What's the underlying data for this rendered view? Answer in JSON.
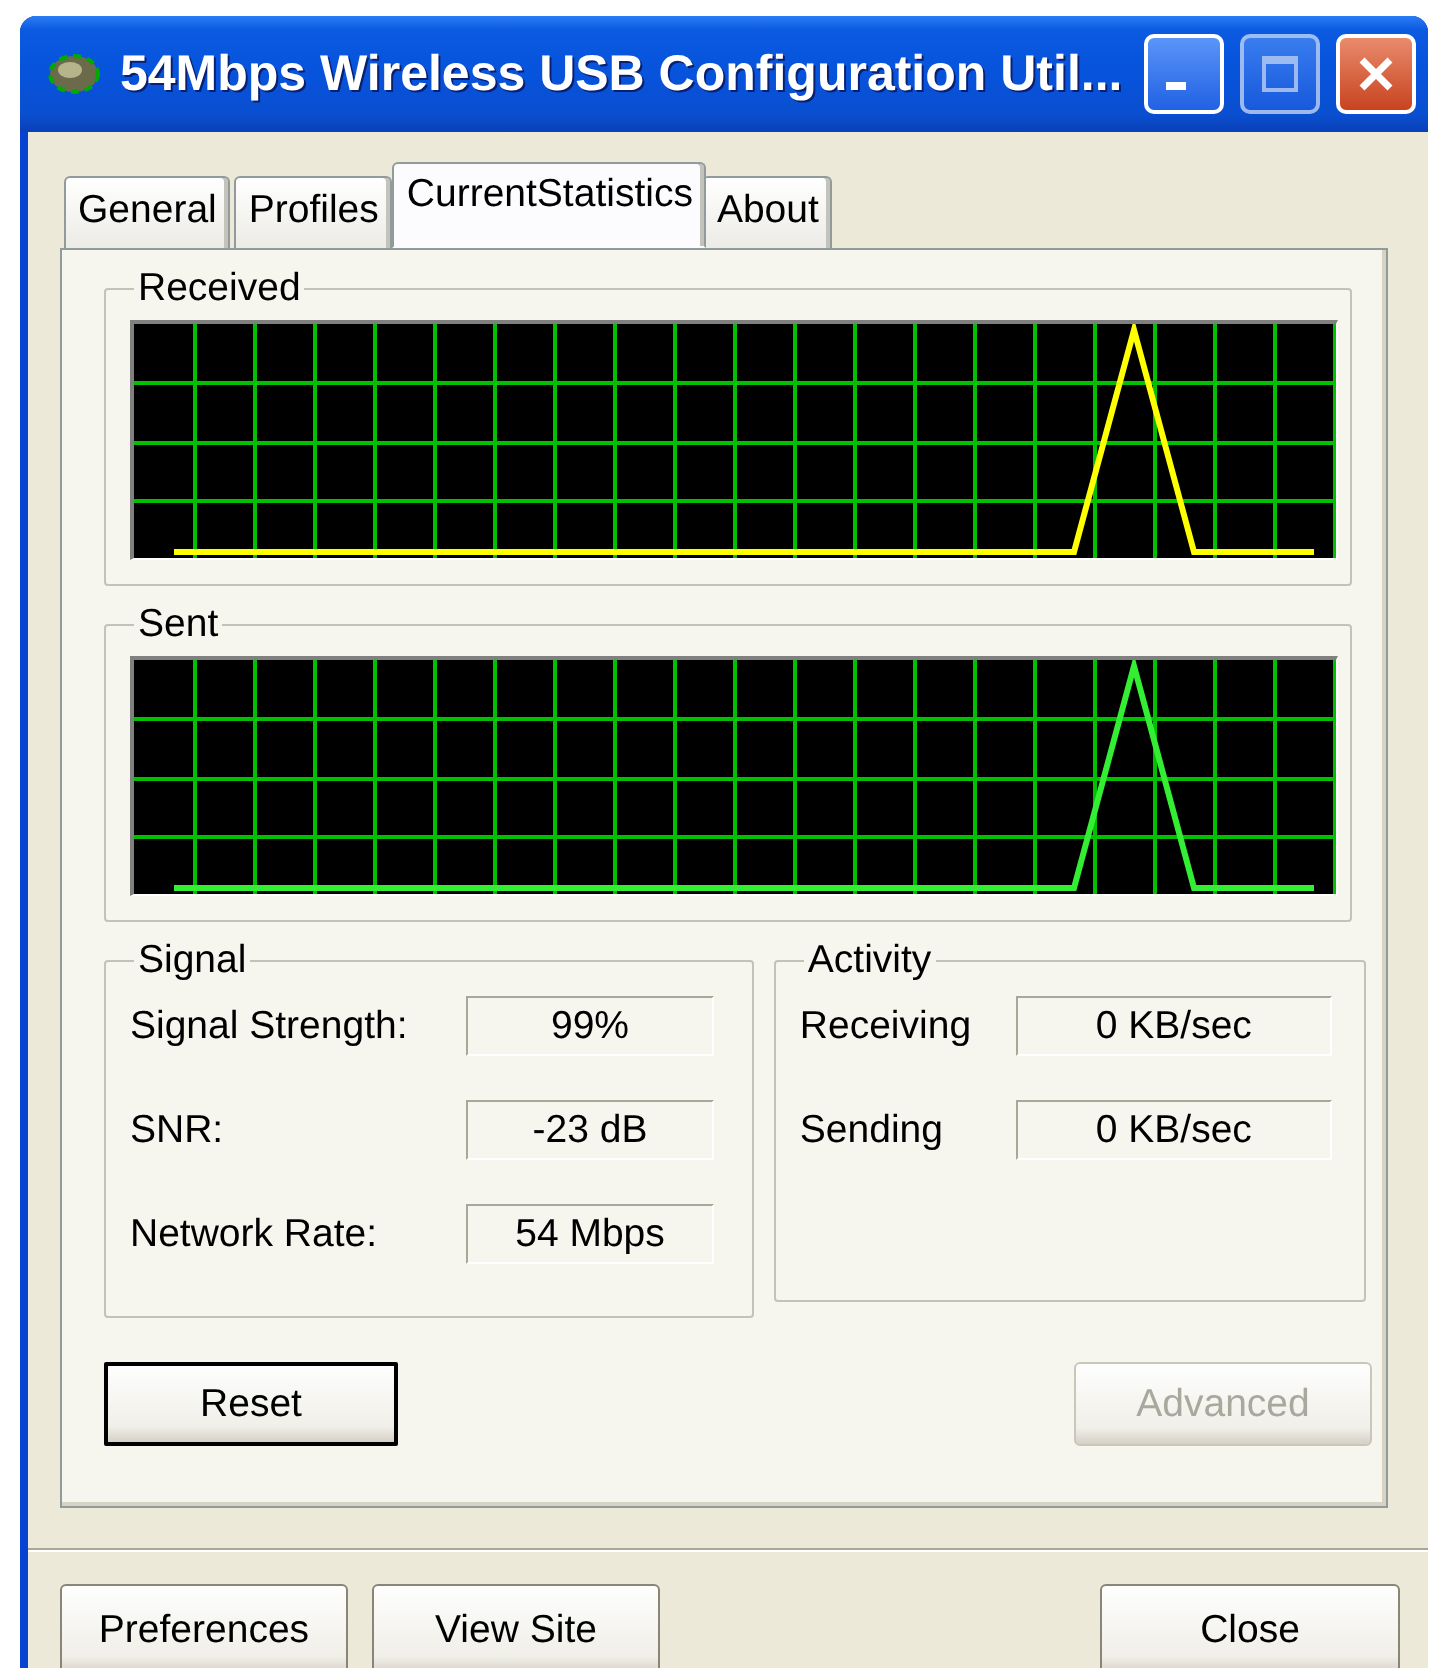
{
  "window": {
    "title": "54Mbps Wireless USB Configuration Util..."
  },
  "tabs": [
    {
      "label": "General",
      "selected": false
    },
    {
      "label": "Profiles",
      "selected": false
    },
    {
      "label": "CurrentStatistics",
      "selected": true
    },
    {
      "label": "About",
      "selected": false
    }
  ],
  "graphs": [
    {
      "title": "Received",
      "color": "#ffff00"
    },
    {
      "title": "Sent",
      "color": "#33ee33"
    }
  ],
  "signal": {
    "title": "Signal",
    "rows": [
      {
        "label": "Signal Strength:",
        "value": "99%"
      },
      {
        "label": "SNR:",
        "value": "-23 dB"
      },
      {
        "label": "Network Rate:",
        "value": "54 Mbps"
      }
    ]
  },
  "activity": {
    "title": "Activity",
    "rows": [
      {
        "label": "Receiving",
        "value": "0 KB/sec"
      },
      {
        "label": "Sending",
        "value": "0 KB/sec"
      }
    ]
  },
  "panel_buttons": [
    {
      "label": "Reset",
      "default": true,
      "disabled": false
    },
    {
      "label": "Advanced",
      "default": false,
      "disabled": true
    }
  ],
  "footer_buttons": [
    {
      "label": "Preferences"
    },
    {
      "label": "View Site"
    },
    {
      "label": "Close"
    }
  ]
}
